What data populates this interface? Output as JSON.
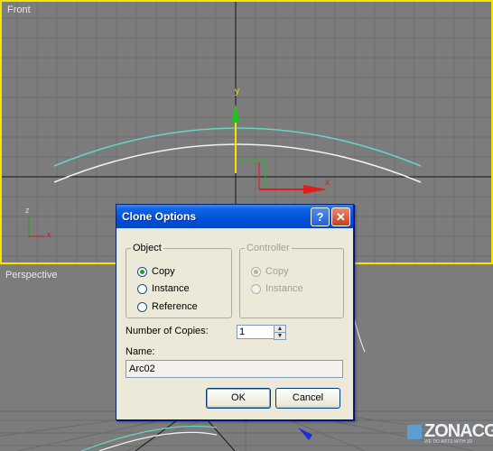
{
  "viewports": {
    "front": {
      "label": "Front",
      "axis": {
        "y": "y",
        "x": "x"
      },
      "triad": {
        "z": "z",
        "x": "x"
      },
      "border_color": "#f2e600"
    },
    "perspective": {
      "label": "Perspective"
    }
  },
  "dialog": {
    "title": "Clone Options",
    "help_icon_glyph": "?",
    "close_icon_glyph": "✕",
    "object_group": {
      "legend": "Object",
      "options": [
        {
          "label": "Copy",
          "checked": true
        },
        {
          "label": "Instance",
          "checked": false
        },
        {
          "label": "Reference",
          "checked": false
        }
      ]
    },
    "controller_group": {
      "legend": "Controller",
      "options": [
        {
          "label": "Copy",
          "checked": true
        },
        {
          "label": "Instance",
          "checked": false
        }
      ]
    },
    "copies": {
      "label": "Number of Copies:",
      "value": "1",
      "up_glyph": "▲",
      "down_glyph": "▼"
    },
    "name": {
      "label": "Name:",
      "value": "Arc02"
    },
    "ok_label": "OK",
    "cancel_label": "Cancel"
  },
  "watermark": {
    "text": "ZONACG",
    "subtitle": "WE DO ARTS WITH 3D"
  },
  "colors": {
    "arc_selected": "#63d6c6",
    "arc_original": "#f3f3f3",
    "gizmo_y": "#1cc51c",
    "gizmo_x": "#e21b1b",
    "dialog_title": "#0050d8"
  }
}
